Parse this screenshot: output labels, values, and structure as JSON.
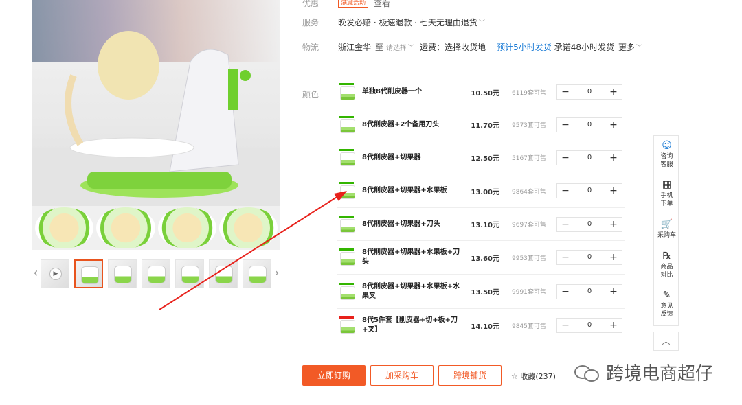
{
  "info": {
    "promo_label": "优惠",
    "promo_badge": "满减活动",
    "promo_more": "查看",
    "service_label": "服务",
    "service_text": "晚发必赔 · 极速退款 · 七天无理由退货",
    "logistics_label": "物流",
    "from_city": "浙江金华",
    "to_word": "至",
    "to_select": "请选择",
    "freight": "运费：选择收货地",
    "ship_time": "预计5小时发货",
    "promise": "承诺48小时发货",
    "more": "更多"
  },
  "color_label": "颜色",
  "skus": [
    {
      "name": "单独8代削皮器一个",
      "price": "10.50元",
      "stock": "6119套可售",
      "qty": "0"
    },
    {
      "name": "8代削皮器+2个备用刀头",
      "price": "11.70元",
      "stock": "9573套可售",
      "qty": "0"
    },
    {
      "name": "8代削皮器+切果器",
      "price": "12.50元",
      "stock": "5167套可售",
      "qty": "0"
    },
    {
      "name": "8代削皮器+切果器+水果板",
      "price": "13.00元",
      "stock": "9864套可售",
      "qty": "0"
    },
    {
      "name": "8代削皮器+切果器+刀头",
      "price": "13.10元",
      "stock": "9697套可售",
      "qty": "0"
    },
    {
      "name": "8代削皮器+切果器+水果板+刀头",
      "price": "13.60元",
      "stock": "9953套可售",
      "qty": "0"
    },
    {
      "name": "8代削皮器+切果器+水果板+水果叉",
      "price": "13.50元",
      "stock": "9991套可售",
      "qty": "0"
    },
    {
      "name": "8代5件套【削皮器+切+板+刀+叉】",
      "price": "14.10元",
      "stock": "9845套可售",
      "qty": "0"
    }
  ],
  "stepper": {
    "minus": "−",
    "plus": "+"
  },
  "side": {
    "consult": "咨询客服",
    "mobile": "手机下单",
    "cart": "采购车",
    "compare": "商品对比",
    "feedback": "意见反馈",
    "top": "︿"
  },
  "actions": {
    "order": "立即订购",
    "add_cart": "加采购车",
    "cross_border": "跨境铺货",
    "favorite": "收藏(237)"
  },
  "watermark": "跨境电商超仔",
  "colors": {
    "accent": "#f25a26",
    "link": "#1a7bd5",
    "annotation": "#e8211b"
  }
}
